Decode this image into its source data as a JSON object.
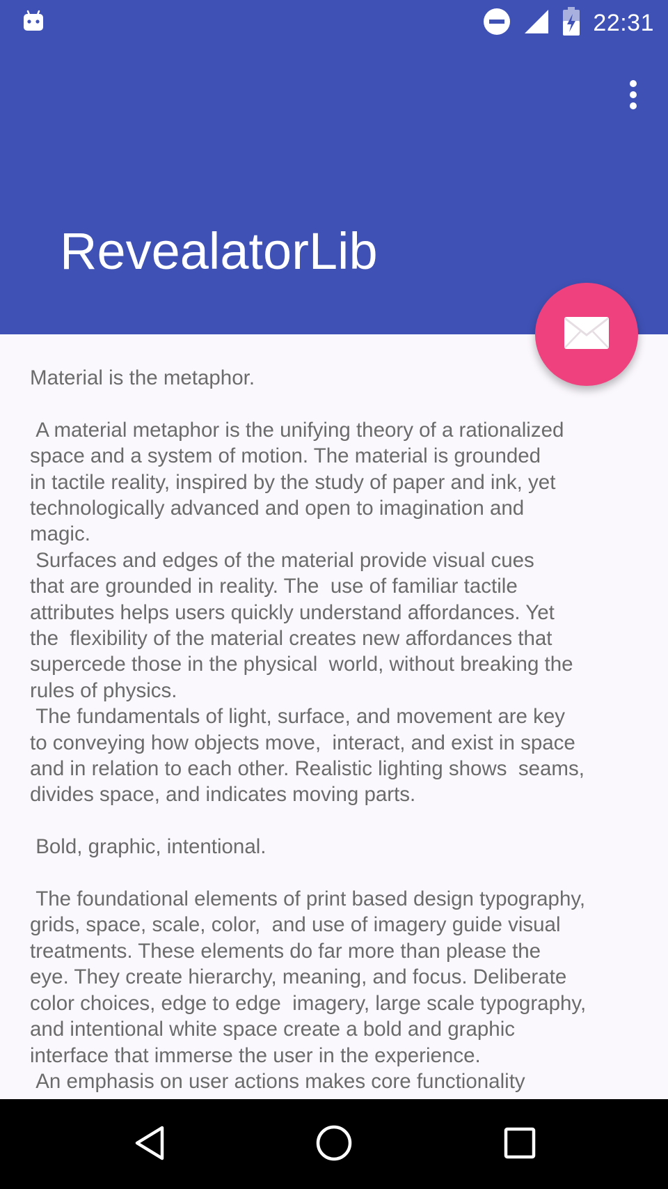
{
  "status_bar": {
    "time": "22:31",
    "icons": [
      "android-icon",
      "do-not-disturb-icon",
      "cell-signal-icon",
      "battery-charging-icon"
    ]
  },
  "app_bar": {
    "title": "RevealatorLib",
    "menu_icon": "more-vert-icon",
    "color": "#3f51b5"
  },
  "fab": {
    "icon": "mail-icon",
    "color": "#f0417f"
  },
  "content": {
    "lines": [
      "Material is the metaphor.",
      "",
      " A material metaphor is the unifying theory of a rationalized",
      "space and a system of motion. The material is grounded",
      "in tactile reality, inspired by the study of paper and ink, yet",
      "technologically advanced and open to imagination and",
      "magic.",
      " Surfaces and edges of the material provide visual cues",
      "that are grounded in reality. The  use of familiar tactile",
      "attributes helps users quickly understand affordances. Yet",
      "the  flexibility of the material creates new affordances that",
      "supercede those in the physical  world, without breaking the",
      "rules of physics.",
      " The fundamentals of light, surface, and movement are key",
      "to conveying how objects move,  interact, and exist in space",
      "and in relation to each other. Realistic lighting shows  seams,",
      "divides space, and indicates moving parts.",
      "",
      " Bold, graphic, intentional.",
      "",
      " The foundational elements of print based design typography,",
      "grids, space, scale, color,  and use of imagery guide visual",
      "treatments. These elements do far more than please the",
      "eye. They create hierarchy, meaning, and focus. Deliberate",
      "color choices, edge to edge  imagery, large scale typography,",
      "and intentional white space create a bold and graphic",
      "interface that immerse the user in the experience.",
      " An emphasis on user actions makes core functionality"
    ]
  },
  "nav_bar": {
    "buttons": [
      "back-icon",
      "home-icon",
      "recents-icon"
    ]
  }
}
